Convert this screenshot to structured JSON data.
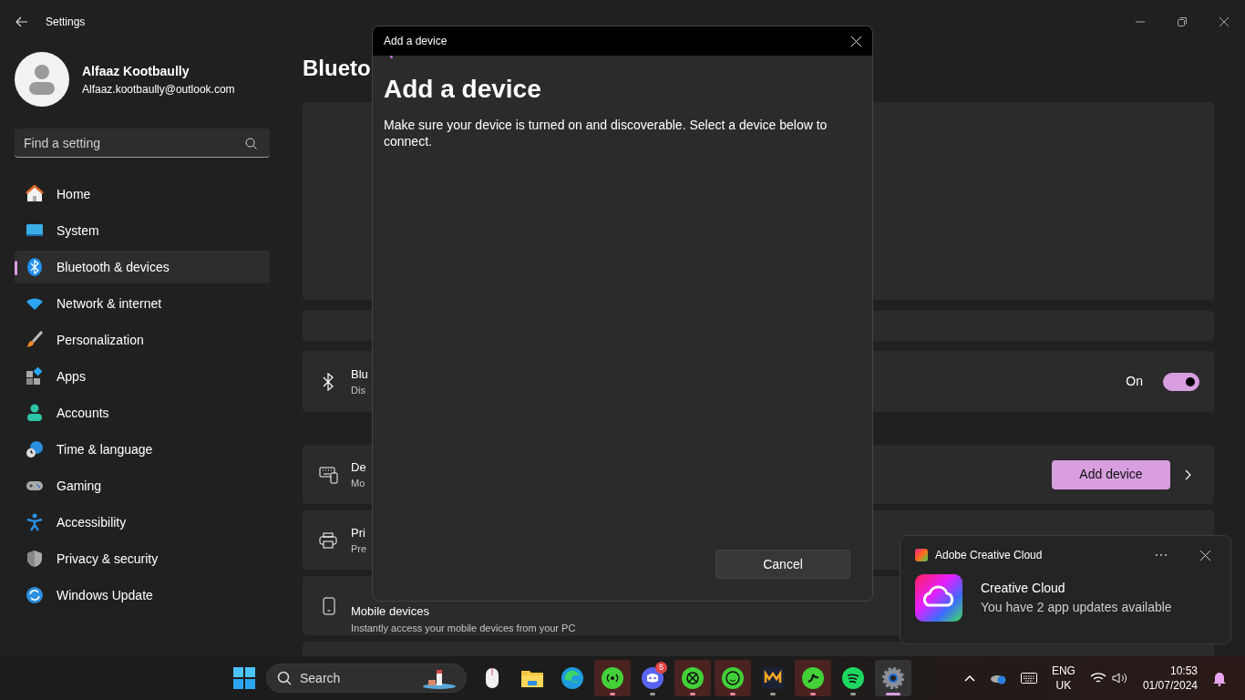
{
  "window": {
    "title": "Settings"
  },
  "user": {
    "name": "Alfaaz Kootbaully",
    "email": "Alfaaz.kootbaully@outlook.com"
  },
  "search": {
    "placeholder": "Find a setting"
  },
  "nav": [
    {
      "label": "Home",
      "selected": false
    },
    {
      "label": "System",
      "selected": false
    },
    {
      "label": "Bluetooth & devices",
      "selected": true
    },
    {
      "label": "Network & internet",
      "selected": false
    },
    {
      "label": "Personalization",
      "selected": false
    },
    {
      "label": "Apps",
      "selected": false
    },
    {
      "label": "Accounts",
      "selected": false
    },
    {
      "label": "Time & language",
      "selected": false
    },
    {
      "label": "Gaming",
      "selected": false
    },
    {
      "label": "Accessibility",
      "selected": false
    },
    {
      "label": "Privacy & security",
      "selected": false
    },
    {
      "label": "Windows Update",
      "selected": false
    }
  ],
  "page": {
    "title": "Blueto"
  },
  "bluetooth_row": {
    "title": "Blu",
    "subtitle": "Dis",
    "state_label": "On",
    "on": true
  },
  "devices_row": {
    "title": "De",
    "subtitle": "Mo",
    "button": "Add device"
  },
  "printers_row": {
    "title": "Pri",
    "subtitle": "Pre"
  },
  "mobile_row": {
    "title": "Mobile devices",
    "subtitle": "Instantly access your mobile devices from your PC"
  },
  "dialog": {
    "title": "Add a device",
    "heading": "Add a device",
    "text": "Make sure your device is turned on and discoverable. Select a device below to connect.",
    "cancel": "Cancel"
  },
  "toast": {
    "app": "Adobe Creative Cloud",
    "title": "Creative Cloud",
    "message": "You have 2 app updates available"
  },
  "taskbar": {
    "search_placeholder": "Search",
    "apps": [
      {
        "running": false,
        "attention": false,
        "selected": false
      },
      {
        "running": false,
        "attention": false,
        "selected": false
      },
      {
        "running": false,
        "attention": false,
        "selected": false
      },
      {
        "running": true,
        "attention": true,
        "selected": false
      },
      {
        "running": true,
        "attention": false,
        "selected": false,
        "badge": "5"
      },
      {
        "running": true,
        "attention": true,
        "selected": false
      },
      {
        "running": true,
        "attention": true,
        "selected": false
      },
      {
        "running": true,
        "attention": false,
        "selected": false
      },
      {
        "running": true,
        "attention": true,
        "selected": false
      },
      {
        "running": true,
        "attention": false,
        "selected": false
      },
      {
        "running": true,
        "attention": false,
        "selected": true
      }
    ],
    "language": "ENG",
    "region": "UK",
    "time": "10:53",
    "date": "01/07/2024"
  }
}
